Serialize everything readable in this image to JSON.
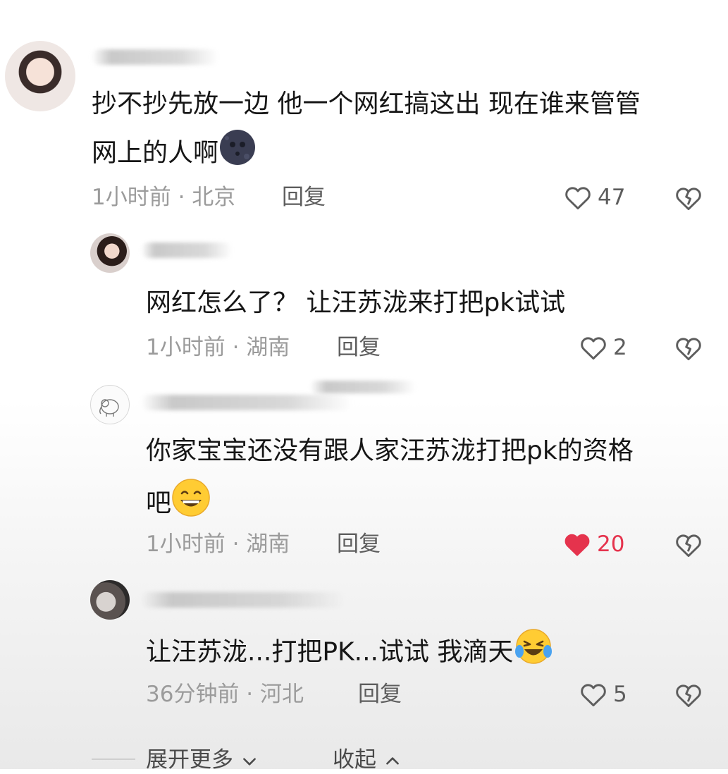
{
  "comments": [
    {
      "text_line1": "抄不抄先放一边 他一个网红搞这出 现在谁来管管",
      "text_line2": "网上的人啊",
      "time_location": "1小时前 · 北京",
      "reply_label": "回复",
      "likes": "47",
      "liked": false
    },
    {
      "text": "网红怎么了？  让汪苏泷来打把pk试试",
      "time_location": "1小时前 · 湖南",
      "reply_label": "回复",
      "likes": "2",
      "liked": false
    },
    {
      "text_line1": "你家宝宝还没有跟人家汪苏泷打把pk的资格",
      "text_line2": "吧",
      "time_location": "1小时前 · 湖南",
      "reply_label": "回复",
      "likes": "20",
      "liked": true
    },
    {
      "text": "让汪苏泷...打把PK...试试 我滴天",
      "time_location": "36分钟前 · 河北",
      "reply_label": "回复",
      "likes": "5",
      "liked": false
    }
  ],
  "footer": {
    "expand_label": "展开更多",
    "collapse_label": "收起"
  },
  "colors": {
    "like_active": "#e5334d",
    "meta_text": "#9b9b9b",
    "main_text": "#161616"
  },
  "icons": [
    "heart-outline-icon",
    "heart-filled-icon",
    "broken-heart-icon",
    "chevron-down-icon",
    "chevron-up-icon",
    "new-moon-face-emoji",
    "grinning-emoji",
    "tears-of-joy-emoji",
    "elephant-avatar-icon"
  ]
}
